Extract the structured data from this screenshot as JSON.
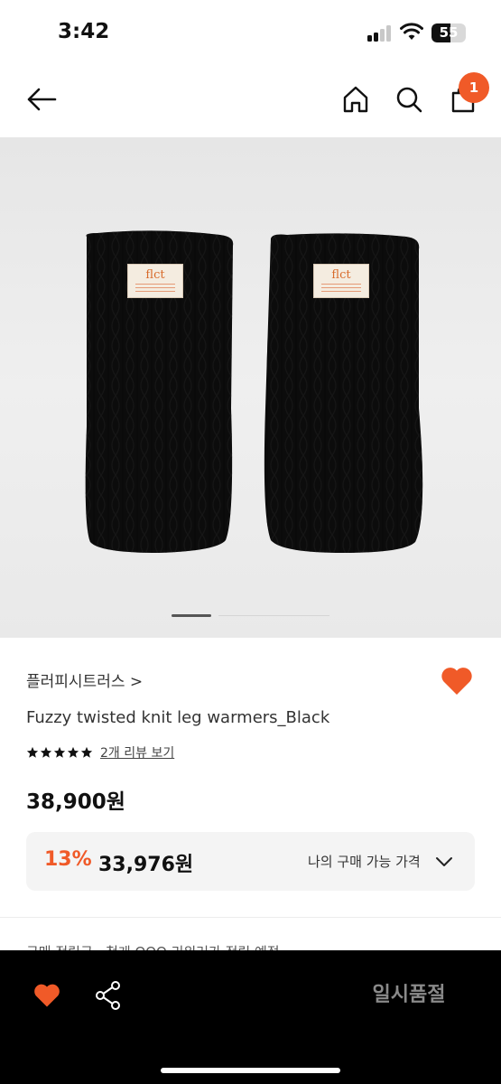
{
  "status_bar": {
    "time": "3:42",
    "battery": "55",
    "battery_level": 0.55,
    "icons": [
      "signal-icon",
      "wifi-icon",
      "battery-icon"
    ]
  },
  "header": {
    "icons": [
      "back-arrow-icon",
      "home-icon",
      "search-icon",
      "cart-icon"
    ],
    "cart_count": "1",
    "badge_color": "#f05a28"
  },
  "gallery": {
    "tag_logo": "flct",
    "current_slide_fraction": 0.25
  },
  "product": {
    "brand": "플러피시트러스 >",
    "name": "Fuzzy twisted knit leg warmers_Black",
    "rating_stars": 5,
    "review_link": "2개 리뷰 보기",
    "price": "38,900원",
    "discount": "13%",
    "my_price": "33,976원",
    "my_price_label": "나의 구매 가능 가격",
    "liked": true,
    "accent_color": "#f05a28"
  },
  "cut_text": "구매 적립금 · 첫게 OOO 리워러가 적립 예정",
  "bottom_bar": {
    "soldout_label": "일시품절",
    "icons": [
      "heart-icon",
      "share-icon"
    ]
  }
}
